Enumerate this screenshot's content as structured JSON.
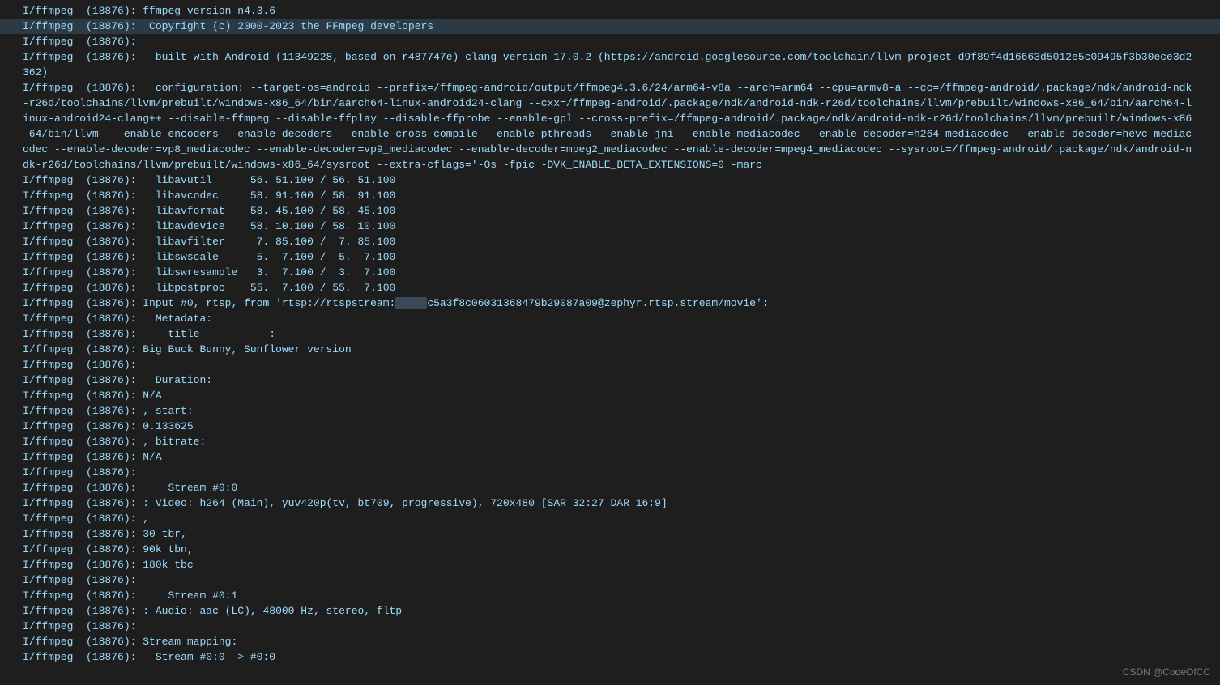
{
  "watermark": "CSDN @CodeOfCC",
  "tag": "I/ffmpeg",
  "pid": "(18876):",
  "redacted_text": "xxxxx",
  "lines": [
    {
      "msg": " ffmpeg version n4.3.6",
      "hl": false
    },
    {
      "msg": "  Copyright (c) 2000-2023 the FFmpeg developers",
      "hl": true
    },
    {
      "msg": "",
      "hl": false
    },
    {
      "msg": "   built with Android (11349228, based on r487747e) clang version 17.0.2 (https://android.googlesource.com/toolchain/llvm-project d9f89f4d16663d5012e5c09495f3b30ece3d2362)",
      "hl": false
    },
    {
      "msg": "   configuration: --target-os=android --prefix=/ffmpeg-android/output/ffmpeg4.3.6/24/arm64-v8a --arch=arm64 --cpu=armv8-a --cc=/ffmpeg-android/.package/ndk/android-ndk-r26d/toolchains/llvm/prebuilt/windows-x86_64/bin/aarch64-linux-android24-clang --cxx=/ffmpeg-android/.package/ndk/android-ndk-r26d/toolchains/llvm/prebuilt/windows-x86_64/bin/aarch64-linux-android24-clang++ --disable-ffmpeg --disable-ffplay --disable-ffprobe --enable-gpl --cross-prefix=/ffmpeg-android/.package/ndk/android-ndk-r26d/toolchains/llvm/prebuilt/windows-x86_64/bin/llvm- --enable-encoders --enable-decoders --enable-cross-compile --enable-pthreads --enable-jni --enable-mediacodec --enable-decoder=h264_mediacodec --enable-decoder=hevc_mediacodec --enable-decoder=vp8_mediacodec --enable-decoder=vp9_mediacodec --enable-decoder=mpeg2_mediacodec --enable-decoder=mpeg4_mediacodec --sysroot=/ffmpeg-android/.package/ndk/android-ndk-r26d/toolchains/llvm/prebuilt/windows-x86_64/sysroot --extra-cflags='-Os -fpic -DVK_ENABLE_BETA_EXTENSIONS=0 -marc",
      "hl": false,
      "wrap": true
    },
    {
      "msg": "   libavutil      56. 51.100 / 56. 51.100",
      "hl": false
    },
    {
      "msg": "   libavcodec     58. 91.100 / 58. 91.100",
      "hl": false
    },
    {
      "msg": "   libavformat    58. 45.100 / 58. 45.100",
      "hl": false
    },
    {
      "msg": "   libavdevice    58. 10.100 / 58. 10.100",
      "hl": false
    },
    {
      "msg": "   libavfilter     7. 85.100 /  7. 85.100",
      "hl": false
    },
    {
      "msg": "   libswscale      5.  7.100 /  5.  7.100",
      "hl": false
    },
    {
      "msg": "   libswresample   3.  7.100 /  3.  7.100",
      "hl": false
    },
    {
      "msg": "   libpostproc    55.  7.100 / 55.  7.100",
      "hl": false
    },
    {
      "msg_pre": " Input #0, rtsp, from 'rtsp://rtspstream:",
      "msg_post": "c5a3f8c06031368479b29087a09@zephyr.rtsp.stream/movie':",
      "redact": true,
      "hl": false
    },
    {
      "msg": "   Metadata:",
      "hl": false
    },
    {
      "msg": "     title           :",
      "hl": false
    },
    {
      "msg": " Big Buck Bunny, Sunflower version",
      "hl": false
    },
    {
      "msg": "",
      "hl": false
    },
    {
      "msg": "   Duration:",
      "hl": false
    },
    {
      "msg": " N/A",
      "hl": false
    },
    {
      "msg": " , start:",
      "hl": false
    },
    {
      "msg": " 0.133625",
      "hl": false
    },
    {
      "msg": " , bitrate:",
      "hl": false
    },
    {
      "msg": " N/A",
      "hl": false
    },
    {
      "msg": "",
      "hl": false
    },
    {
      "msg": "     Stream #0:0",
      "hl": false
    },
    {
      "msg": " : Video: h264 (Main), yuv420p(tv, bt709, progressive), 720x480 [SAR 32:27 DAR 16:9]",
      "hl": false
    },
    {
      "msg": " ,",
      "hl": false
    },
    {
      "msg": " 30 tbr,",
      "hl": false
    },
    {
      "msg": " 90k tbn,",
      "hl": false
    },
    {
      "msg": " 180k tbc",
      "hl": false
    },
    {
      "msg": "",
      "hl": false
    },
    {
      "msg": "     Stream #0:1",
      "hl": false
    },
    {
      "msg": " : Audio: aac (LC), 48000 Hz, stereo, fltp",
      "hl": false
    },
    {
      "msg": "",
      "hl": false
    },
    {
      "msg": " Stream mapping:",
      "hl": false
    },
    {
      "msg": "   Stream #0:0 -> #0:0",
      "hl": false
    }
  ]
}
